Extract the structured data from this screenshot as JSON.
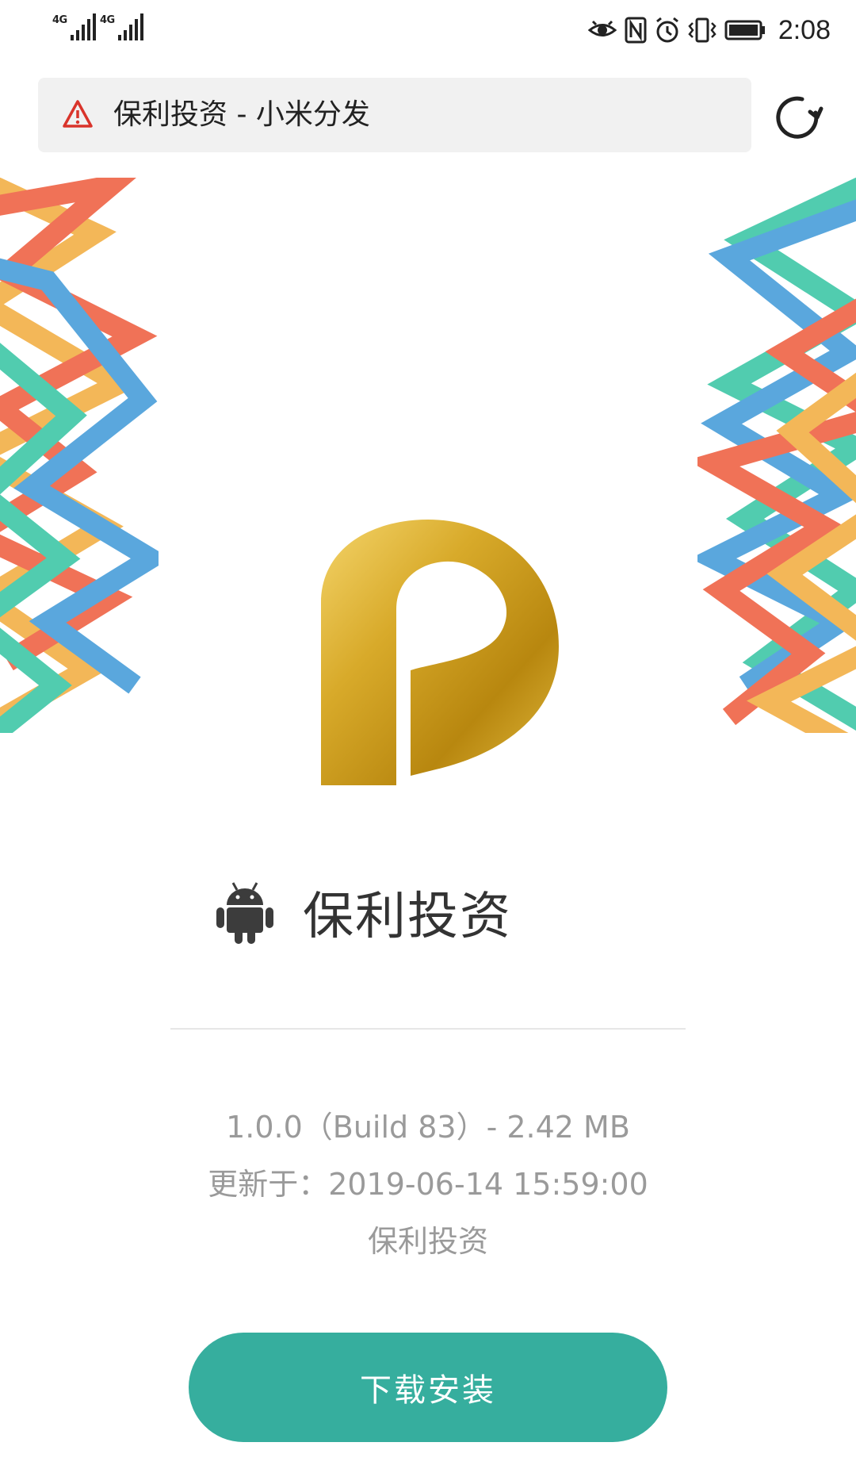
{
  "status_bar": {
    "sim1_network": "4G",
    "sim2_network": "4G",
    "time": "2:08",
    "icons": [
      "eye-icon",
      "nfc-icon",
      "alarm-icon",
      "vibrate-icon",
      "battery-icon"
    ]
  },
  "address_bar": {
    "title": "保利投资 - 小米分发",
    "warning_icon": "warning-triangle-icon",
    "reload_icon": "reload-icon"
  },
  "app": {
    "platform_icon": "android-icon",
    "name": "保利投资",
    "version_line": "1.0.0（Build 83）- 2.42 MB",
    "updated_line": "更新于：2019-06-14 15:59:00",
    "publisher": "保利投资"
  },
  "install_button": {
    "label": "下载安装"
  },
  "colors": {
    "button": "#36ae9e",
    "logo_gold": "#d8aa2a",
    "pattern": [
      "#f1ab3c",
      "#ee5a3a",
      "#3e98d8",
      "#33c4a2"
    ]
  }
}
